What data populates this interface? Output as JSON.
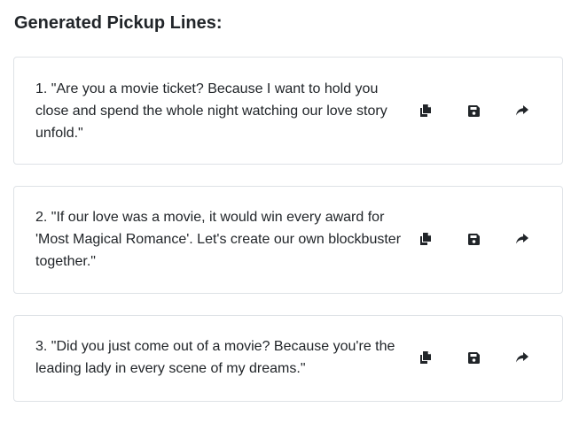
{
  "header": {
    "title": "Generated Pickup Lines:"
  },
  "pickup_lines": [
    {
      "text": "1. \"Are you a movie ticket? Because I want to hold you close and spend the whole night watching our love story unfold.\"",
      "actions": [
        "copy-icon",
        "save-icon",
        "share-icon"
      ]
    },
    {
      "text": "2. \"If our love was a movie, it would win every award for 'Most Magical Romance'. Let's create our own blockbuster together.\"",
      "actions": [
        "copy-icon",
        "save-icon",
        "share-icon"
      ]
    },
    {
      "text": "3. \"Did you just come out of a movie? Because you're the leading lady in every scene of my dreams.\"",
      "actions": [
        "copy-icon",
        "save-icon",
        "share-icon"
      ]
    }
  ],
  "colors": {
    "text": "#212529",
    "card_border": "#dee2e6",
    "icon": "#212529"
  }
}
